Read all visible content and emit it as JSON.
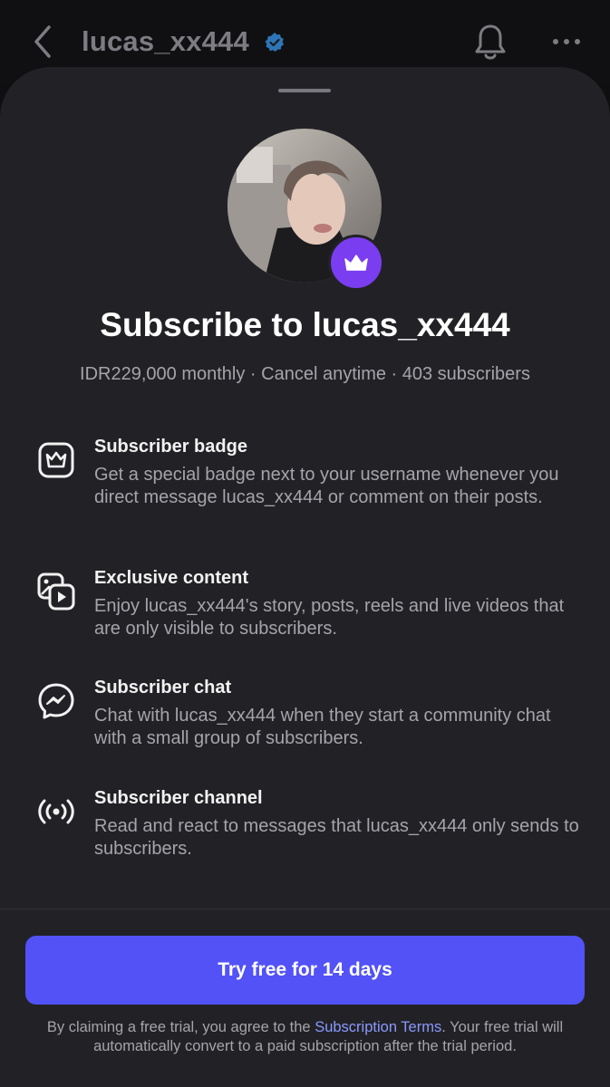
{
  "header": {
    "username": "lucas_xx444",
    "verified_icon": "verified-badge-icon",
    "back_icon": "chevron-left-icon",
    "bell_icon": "bell-icon",
    "more_icon": "more-horizontal-icon"
  },
  "sheet": {
    "title": "Subscribe to lucas_xx444",
    "meta": "IDR229,000 monthly · Cancel anytime · 403 subscribers",
    "features": [
      {
        "icon": "crown-badge-icon",
        "title": "Subscriber badge",
        "description": "Get a special badge next to your username whenever you direct message lucas_xx444 or comment on their posts."
      },
      {
        "icon": "media-gallery-icon",
        "title": "Exclusive content",
        "description": "Enjoy lucas_xx444's story, posts, reels and live videos that are only visible to subscribers."
      },
      {
        "icon": "messenger-icon",
        "title": "Subscriber chat",
        "description": "Chat with lucas_xx444 when they start a community chat with a small group of subscribers."
      },
      {
        "icon": "broadcast-icon",
        "title": "Subscriber channel",
        "description": "Read and react to messages that lucas_xx444 only sends to subscribers."
      }
    ],
    "cta_label": "Try free for 14 days",
    "legal": {
      "before": "By claiming a free trial, you agree to the ",
      "link": "Subscription Terms",
      "after": ". Your free trial will automatically convert to a paid subscription after the trial period."
    }
  },
  "colors": {
    "sheet_bg": "#222226",
    "accent_button": "#5252f7",
    "crown_badge": "#7a3df0",
    "link": "#8a99ff",
    "verified": "#3897f0"
  }
}
